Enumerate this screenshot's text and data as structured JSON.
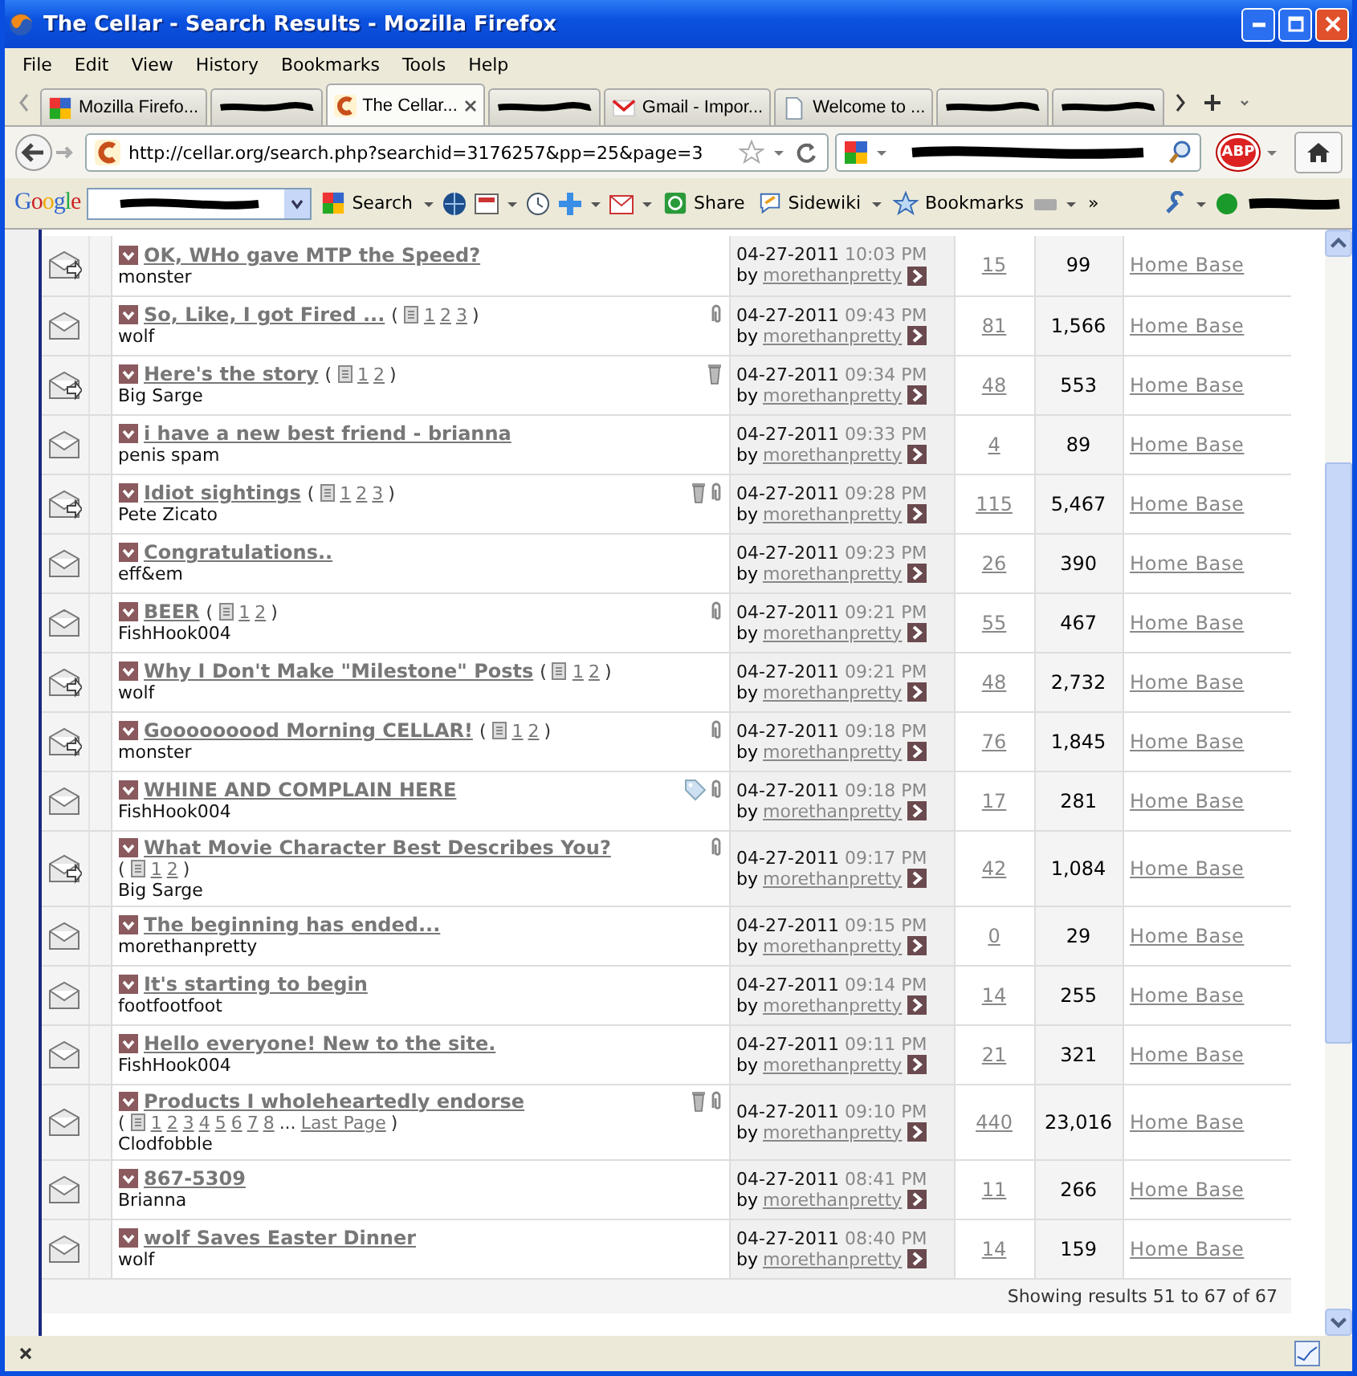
{
  "window": {
    "title": "The Cellar - Search Results - Mozilla Firefox"
  },
  "menu": [
    "File",
    "Edit",
    "View",
    "History",
    "Bookmarks",
    "Tools",
    "Help"
  ],
  "tabs": [
    {
      "kind": "google",
      "label": "Mozilla Firefo...",
      "selected": false
    },
    {
      "kind": "redacted",
      "selected": false
    },
    {
      "kind": "cellar",
      "label": "The Cellar...",
      "selected": true
    },
    {
      "kind": "redacted",
      "selected": false
    },
    {
      "kind": "gmail",
      "label": "Gmail - Impor...",
      "selected": false
    },
    {
      "kind": "doc",
      "label": "Welcome to ...",
      "selected": false
    },
    {
      "kind": "redacted",
      "selected": false
    },
    {
      "kind": "redacted",
      "selected": false
    }
  ],
  "address_bar": {
    "url": "http://cellar.org/search.php?searchid=3176257&pp=25&page=3"
  },
  "adblock": {
    "label": "ABP"
  },
  "google_toolbar": {
    "logo": "Google",
    "search": "Search",
    "share": "Share",
    "sidewiki": "Sidewiki",
    "bookmarks": "Bookmarks",
    "more": "»"
  },
  "threads": [
    {
      "arrow": true,
      "title": "OK, WHo gave MTP the Speed?",
      "author": "monster",
      "tag": false,
      "trash": false,
      "attachment": false,
      "date": "04-27-2011",
      "time": "10:03 PM",
      "by": "by",
      "last_poster": "morethanpretty",
      "replies": "15",
      "views": "99",
      "forum": "Home Base"
    },
    {
      "arrow": false,
      "title": "So, Like, I got Fired ...",
      "pager": {
        "open": "(",
        "pages": [
          "1",
          "2",
          "3"
        ],
        "close": ")"
      },
      "author": "wolf",
      "tag": false,
      "trash": false,
      "attachment": true,
      "date": "04-27-2011",
      "time": "09:43 PM",
      "by": "by",
      "last_poster": "morethanpretty",
      "replies": "81",
      "views": "1,566",
      "forum": "Home Base"
    },
    {
      "arrow": true,
      "title": "Here's the story",
      "pager": {
        "open": "(",
        "pages": [
          "1",
          "2"
        ],
        "close": ")"
      },
      "author": "Big Sarge",
      "tag": false,
      "trash": true,
      "attachment": false,
      "date": "04-27-2011",
      "time": "09:34 PM",
      "by": "by",
      "last_poster": "morethanpretty",
      "replies": "48",
      "views": "553",
      "forum": "Home Base"
    },
    {
      "arrow": false,
      "title": "i have a new best friend - brianna",
      "author": "penis spam",
      "tag": false,
      "trash": false,
      "attachment": false,
      "date": "04-27-2011",
      "time": "09:33 PM",
      "by": "by",
      "last_poster": "morethanpretty",
      "replies": "4",
      "views": "89",
      "forum": "Home Base"
    },
    {
      "arrow": true,
      "title": "Idiot sightings",
      "pager": {
        "open": "(",
        "pages": [
          "1",
          "2",
          "3"
        ],
        "close": ")"
      },
      "author": "Pete Zicato",
      "tag": false,
      "trash": true,
      "attachment": true,
      "date": "04-27-2011",
      "time": "09:28 PM",
      "by": "by",
      "last_poster": "morethanpretty",
      "replies": "115",
      "views": "5,467",
      "forum": "Home Base"
    },
    {
      "arrow": false,
      "title": "Congratulations..",
      "author": "eff&em",
      "tag": false,
      "trash": false,
      "attachment": false,
      "date": "04-27-2011",
      "time": "09:23 PM",
      "by": "by",
      "last_poster": "morethanpretty",
      "replies": "26",
      "views": "390",
      "forum": "Home Base"
    },
    {
      "arrow": false,
      "title": "BEER",
      "pager": {
        "open": "(",
        "pages": [
          "1",
          "2"
        ],
        "close": ")"
      },
      "author": "FishHook004",
      "tag": false,
      "trash": false,
      "attachment": true,
      "date": "04-27-2011",
      "time": "09:21 PM",
      "by": "by",
      "last_poster": "morethanpretty",
      "replies": "55",
      "views": "467",
      "forum": "Home Base"
    },
    {
      "arrow": true,
      "title": "Why I Don't Make \"Milestone\" Posts",
      "pager": {
        "open": "(",
        "pages": [
          "1",
          "2"
        ],
        "close": ")"
      },
      "author": "wolf",
      "tag": false,
      "trash": false,
      "attachment": false,
      "date": "04-27-2011",
      "time": "09:21 PM",
      "by": "by",
      "last_poster": "morethanpretty",
      "replies": "48",
      "views": "2,732",
      "forum": "Home Base"
    },
    {
      "arrow": true,
      "title": "Gooooooood Morning CELLAR!",
      "pager": {
        "open": "(",
        "pages": [
          "1",
          "2"
        ],
        "close": ")"
      },
      "author": "monster",
      "tag": false,
      "trash": false,
      "attachment": true,
      "date": "04-27-2011",
      "time": "09:18 PM",
      "by": "by",
      "last_poster": "morethanpretty",
      "replies": "76",
      "views": "1,845",
      "forum": "Home Base"
    },
    {
      "arrow": false,
      "title": "WHINE AND COMPLAIN HERE",
      "author": "FishHook004",
      "tag": true,
      "trash": false,
      "attachment": true,
      "date": "04-27-2011",
      "time": "09:18 PM",
      "by": "by",
      "last_poster": "morethanpretty",
      "replies": "17",
      "views": "281",
      "forum": "Home Base"
    },
    {
      "arrow": true,
      "title": "What Movie Character Best Describes You?",
      "pager": {
        "open": "(",
        "pages": [
          "1",
          "2"
        ],
        "close": ")",
        "wrap": true
      },
      "author": "Big Sarge",
      "tag": false,
      "trash": false,
      "attachment": true,
      "date": "04-27-2011",
      "time": "09:17 PM",
      "by": "by",
      "last_poster": "morethanpretty",
      "replies": "42",
      "views": "1,084",
      "forum": "Home Base"
    },
    {
      "arrow": false,
      "title": "The beginning has ended...",
      "author": "morethanpretty",
      "tag": false,
      "trash": false,
      "attachment": false,
      "date": "04-27-2011",
      "time": "09:15 PM",
      "by": "by",
      "last_poster": "morethanpretty",
      "replies": "0",
      "views": "29",
      "forum": "Home Base"
    },
    {
      "arrow": false,
      "title": "It's starting to begin",
      "author": "footfootfoot",
      "tag": false,
      "trash": false,
      "attachment": false,
      "date": "04-27-2011",
      "time": "09:14 PM",
      "by": "by",
      "last_poster": "morethanpretty",
      "replies": "14",
      "views": "255",
      "forum": "Home Base"
    },
    {
      "arrow": false,
      "title": "Hello everyone! New to the site.",
      "author": "FishHook004",
      "tag": false,
      "trash": false,
      "attachment": false,
      "date": "04-27-2011",
      "time": "09:11 PM",
      "by": "by",
      "last_poster": "morethanpretty",
      "replies": "21",
      "views": "321",
      "forum": "Home Base"
    },
    {
      "arrow": false,
      "title": "Products I wholeheartedly endorse",
      "pager": {
        "open": "(",
        "pages": [
          "1",
          "2",
          "3",
          "4",
          "5",
          "6",
          "7",
          "8"
        ],
        "ellipsis": "...",
        "last_page": "Last Page",
        "close": ")",
        "wrap": true
      },
      "author": "Clodfobble",
      "tag": false,
      "trash": true,
      "attachment": true,
      "date": "04-27-2011",
      "time": "09:10 PM",
      "by": "by",
      "last_poster": "morethanpretty",
      "replies": "440",
      "views": "23,016",
      "forum": "Home Base"
    },
    {
      "arrow": false,
      "title": "867-5309",
      "author": "Brianna",
      "tag": false,
      "trash": false,
      "attachment": false,
      "date": "04-27-2011",
      "time": "08:41 PM",
      "by": "by",
      "last_poster": "morethanpretty",
      "replies": "11",
      "views": "266",
      "forum": "Home Base"
    },
    {
      "arrow": false,
      "title": "wolf Saves Easter Dinner",
      "author": "wolf",
      "tag": false,
      "trash": false,
      "attachment": false,
      "date": "04-27-2011",
      "time": "08:40 PM",
      "by": "by",
      "last_poster": "morethanpretty",
      "replies": "14",
      "views": "159",
      "forum": "Home Base"
    }
  ],
  "footer": "Showing results 51 to 67 of 67"
}
